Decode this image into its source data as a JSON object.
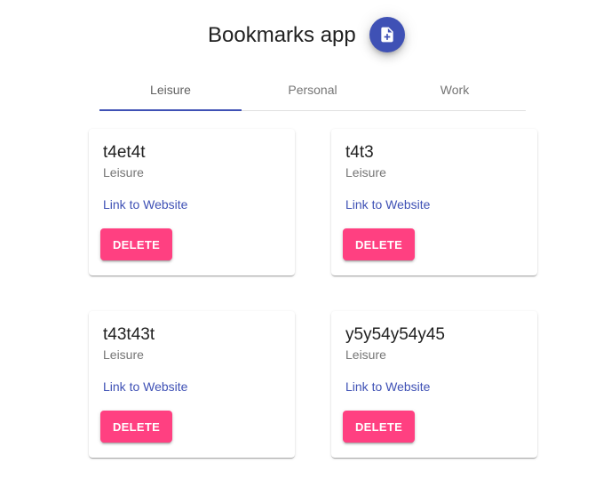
{
  "header": {
    "title": "Bookmarks app",
    "add_button_icon": "note-add-icon",
    "accent_color": "#3f51b5"
  },
  "tabs": [
    {
      "label": "Leisure",
      "active": true
    },
    {
      "label": "Personal",
      "active": false
    },
    {
      "label": "Work",
      "active": false
    }
  ],
  "bookmarks": [
    {
      "title": "t4et4t",
      "category": "Leisure",
      "link_label": "Link to Website",
      "delete_label": "DELETE"
    },
    {
      "title": "t4t3",
      "category": "Leisure",
      "link_label": "Link to Website",
      "delete_label": "DELETE"
    },
    {
      "title": "t43t43t",
      "category": "Leisure",
      "link_label": "Link to Website",
      "delete_label": "DELETE"
    },
    {
      "title": "y5y54y54y45",
      "category": "Leisure",
      "link_label": "Link to Website",
      "delete_label": "DELETE"
    }
  ],
  "colors": {
    "primary": "#3f51b5",
    "delete": "#ff4081"
  }
}
